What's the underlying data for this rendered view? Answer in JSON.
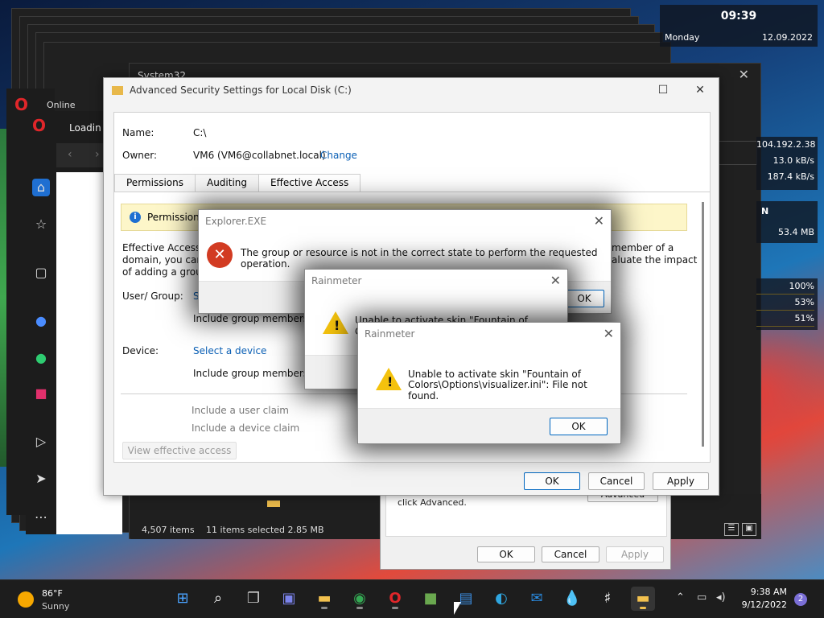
{
  "desktop": {
    "rainmeter": {
      "time": "09:39",
      "day": "Monday",
      "date": "12.09.2022",
      "ip": "104.192.2.38",
      "net_up": "13.0 kB/s",
      "net_down": "187.4 kB/s",
      "mem_letter": "N",
      "mem_value": "53.4 MB",
      "cpu": [
        "100%",
        "53%",
        "51%"
      ]
    }
  },
  "background_windows": {
    "system32_title": "System32",
    "loading_tab": "Loadin",
    "online_tab": "Online C"
  },
  "advanced_security": {
    "title": "Advanced Security Settings for Local Disk (C:)",
    "name_label": "Name:",
    "name_value": "C:\\",
    "owner_label": "Owner:",
    "owner_value": "VM6 (VM6@collabnet.local)",
    "change_link": "Change",
    "tabs": [
      "Permissions",
      "Auditing",
      "Effective Access"
    ],
    "banner_text": "Permission",
    "desc_left_1": "Effective Access a",
    "desc_left_2": "domain, you can",
    "desc_left_3": "of adding a group",
    "desc_right_1": "member of a",
    "desc_right_2": "aluate the impact",
    "user_group_label": "User/ Group:",
    "user_group_value": "S",
    "include_group_1": "Include group membershi",
    "device_label": "Device:",
    "select_device": "Select a device",
    "include_group_2": "Include group membershi",
    "include_user_claim": "Include a user claim",
    "include_device_claim": "Include a device claim",
    "view_effective_access": "View effective access",
    "ok": "OK",
    "cancel": "Cancel",
    "apply": "Apply"
  },
  "explorer_error": {
    "title": "Explorer.EXE",
    "message": "The group or resource is not in the correct state to perform the requested operation.",
    "ok": "OK"
  },
  "rainmeter_back": {
    "title": "Rainmeter",
    "message": "Unable to activate skin \"Fountain of",
    "message2": "C"
  },
  "rainmeter_front": {
    "title": "Rainmeter",
    "message_line1": "Unable to activate skin \"Fountain of",
    "message_line2": "Colors\\Options\\visualizer.ini\": File not found.",
    "ok": "OK"
  },
  "file_explorer": {
    "items": "4,507 items",
    "selected": "11 items selected  2.85 MB"
  },
  "properties_dialog": {
    "hint": "click Advanced.",
    "advanced": "Advanced",
    "ok": "OK",
    "cancel": "Cancel",
    "apply": "Apply"
  },
  "taskbar": {
    "weather_temp": "86°F",
    "weather_desc": "Sunny",
    "clock_time": "9:38 AM",
    "clock_date": "9/12/2022",
    "notification_count": "2"
  }
}
